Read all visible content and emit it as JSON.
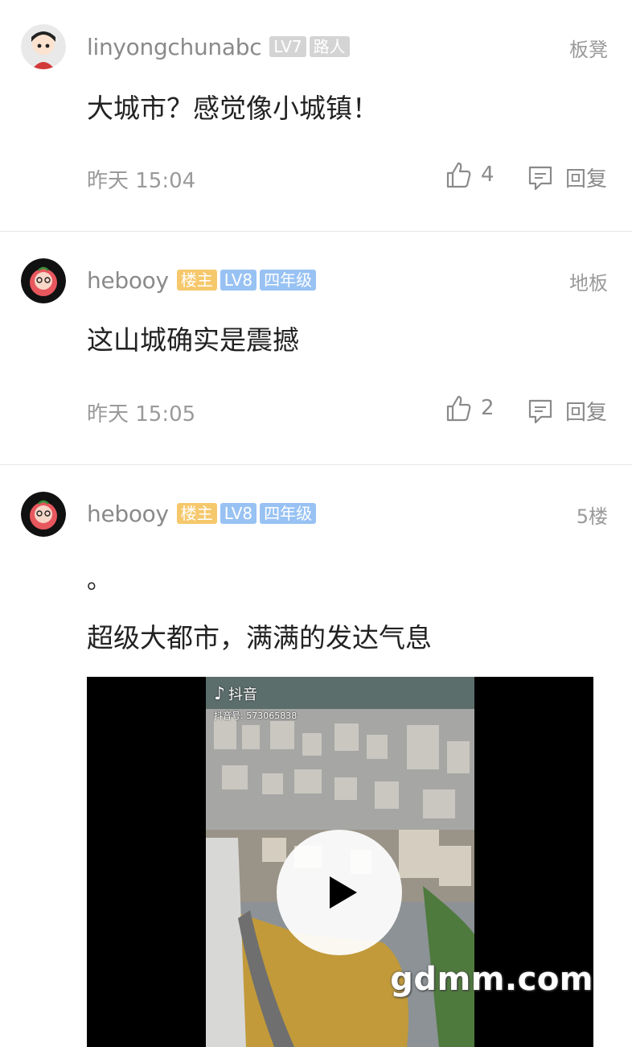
{
  "posts": [
    {
      "username": "linyongchunabc",
      "badges": [
        "LV7",
        "路人"
      ],
      "floor": "板凳",
      "content": "大城市？感觉像小城镇！",
      "time": "昨天 15:04",
      "likes": "4",
      "reply_label": "回复"
    },
    {
      "username": "hebooy",
      "badges": [
        "楼主",
        "LV8",
        "四年级"
      ],
      "floor": "地板",
      "content": "这山城确实是震撼",
      "time": "昨天 15:05",
      "likes": "2",
      "reply_label": "回复"
    },
    {
      "username": "hebooy",
      "badges": [
        "楼主",
        "LV8",
        "四年级"
      ],
      "floor": "5楼",
      "content_line1": "。",
      "content_line2": "超级大都市，满满的发达气息",
      "video": {
        "app_name": "抖音",
        "account": "抖音号: 573065838"
      }
    }
  ],
  "watermark": "gdmm.com"
}
